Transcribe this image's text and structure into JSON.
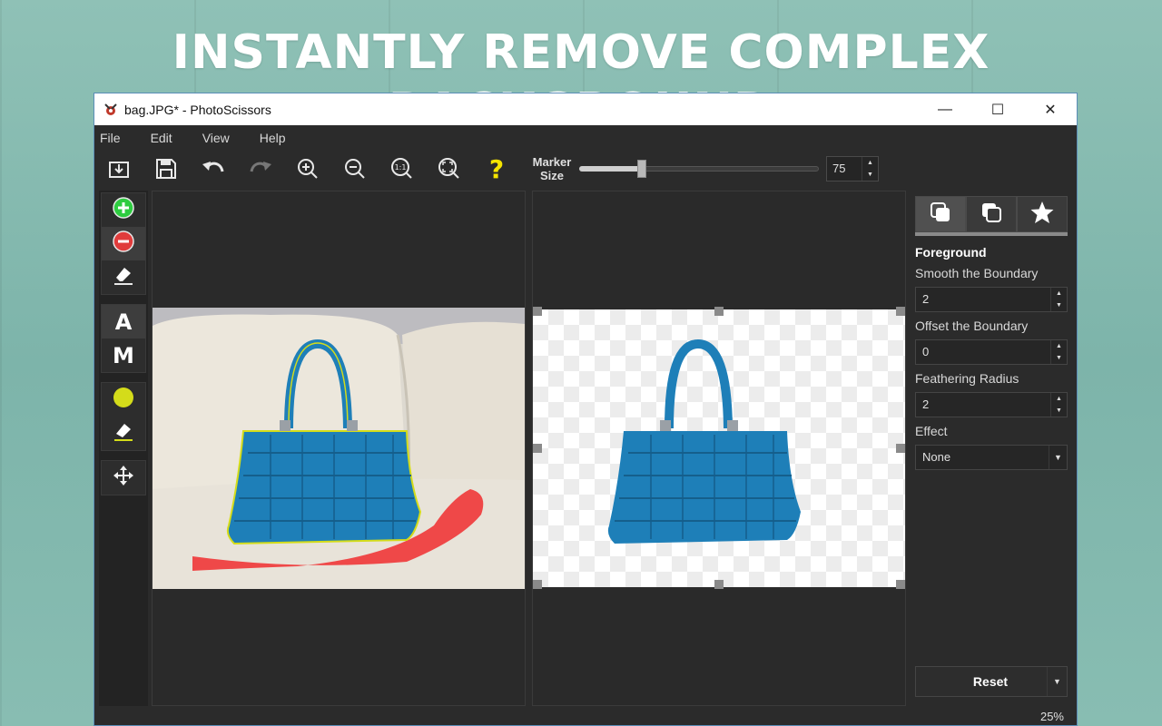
{
  "headline": "INSTANTLY REMOVE COMPLEX BACKGROUND",
  "window": {
    "title": "bag.JPG* - PhotoScissors",
    "controls": {
      "minimize": "—",
      "maximize": "☐",
      "close": "✕"
    }
  },
  "menu": [
    "File",
    "Edit",
    "View",
    "Help"
  ],
  "toolbar": {
    "buttons": [
      "open-icon",
      "save-icon",
      "undo-icon",
      "redo-icon",
      "zoom-in-icon",
      "zoom-out-icon",
      "zoom-actual-icon",
      "zoom-fit-icon",
      "help-icon"
    ],
    "actual_size_text": "1:1",
    "help_text": "?",
    "marker_label_1": "Marker",
    "marker_label_2": "Size",
    "marker_size_value": "75",
    "marker_size_fraction": 0.26
  },
  "tools": {
    "foreground_marker": "foreground-marker-icon",
    "background_marker": "background-marker-icon",
    "eraser": "eraser-icon",
    "auto_mode": "A",
    "manual_mode": "M",
    "hair_marker": "hair-marker-icon",
    "hair_eraser": "hair-eraser-icon",
    "move": "move-icon"
  },
  "panel": {
    "tabs": [
      "foreground-tab-icon",
      "background-tab-icon",
      "effects-tab-icon"
    ],
    "title": "Foreground",
    "smooth_label": "Smooth the Boundary",
    "smooth_value": "2",
    "offset_label": "Offset the Boundary",
    "offset_value": "0",
    "feather_label": "Feathering Radius",
    "feather_value": "2",
    "effect_label": "Effect",
    "effect_value": "None",
    "reset_label": "Reset"
  },
  "status": {
    "zoom": "25%"
  },
  "colors": {
    "foreground_marker": "#2ecc40",
    "background_marker": "#e03c3c",
    "hair_marker": "#d4dc1a",
    "bag": "#1e7fb8",
    "background_stroke": "#ef4848"
  }
}
